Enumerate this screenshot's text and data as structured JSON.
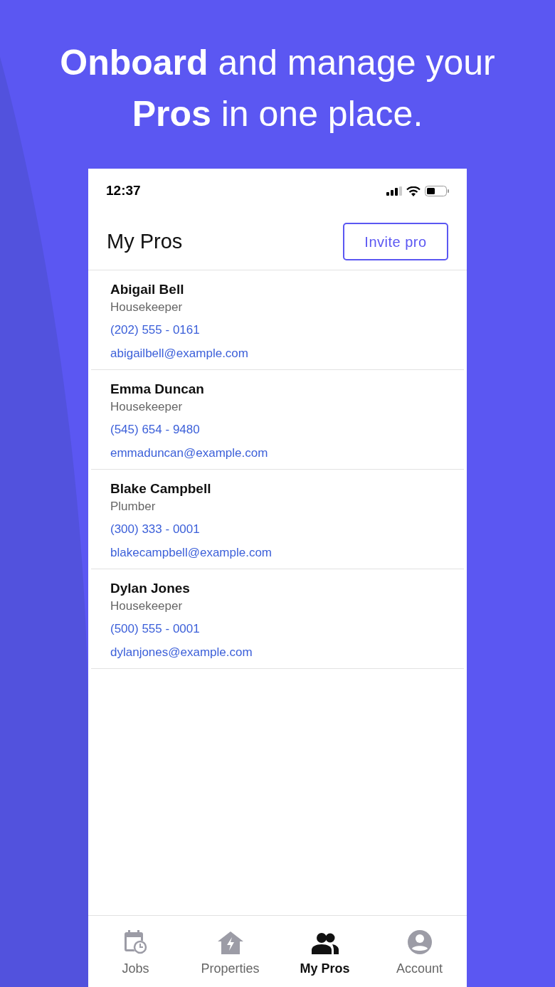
{
  "headline": "**Onboard** and manage your **Pros** in one place.",
  "status_bar": {
    "time": "12:37"
  },
  "header": {
    "title": "My Pros",
    "button": "Invite pro"
  },
  "pros": [
    {
      "name": "Abigail Bell",
      "role": "Housekeeper",
      "phone": "(202) 555 - 0161",
      "email": "abigailbell@example.com"
    },
    {
      "name": "Emma Duncan",
      "role": "Housekeeper",
      "phone": "(545) 654 - 9480",
      "email": "emmaduncan@example.com"
    },
    {
      "name": "Blake Campbell",
      "role": "Plumber",
      "phone": "(300) 333 - 0001",
      "email": "blakecampbell@example.com"
    },
    {
      "name": "Dylan Jones",
      "role": "Housekeeper",
      "phone": "(500) 555 - 0001",
      "email": "dylanjones@example.com"
    }
  ],
  "tabs": [
    {
      "kind": "calendar",
      "label": "Jobs",
      "selected": false
    },
    {
      "kind": "house",
      "label": "Properties",
      "selected": false
    },
    {
      "kind": "people",
      "label": "My Pros",
      "selected": true
    },
    {
      "kind": "person",
      "label": "Account",
      "selected": false
    }
  ]
}
